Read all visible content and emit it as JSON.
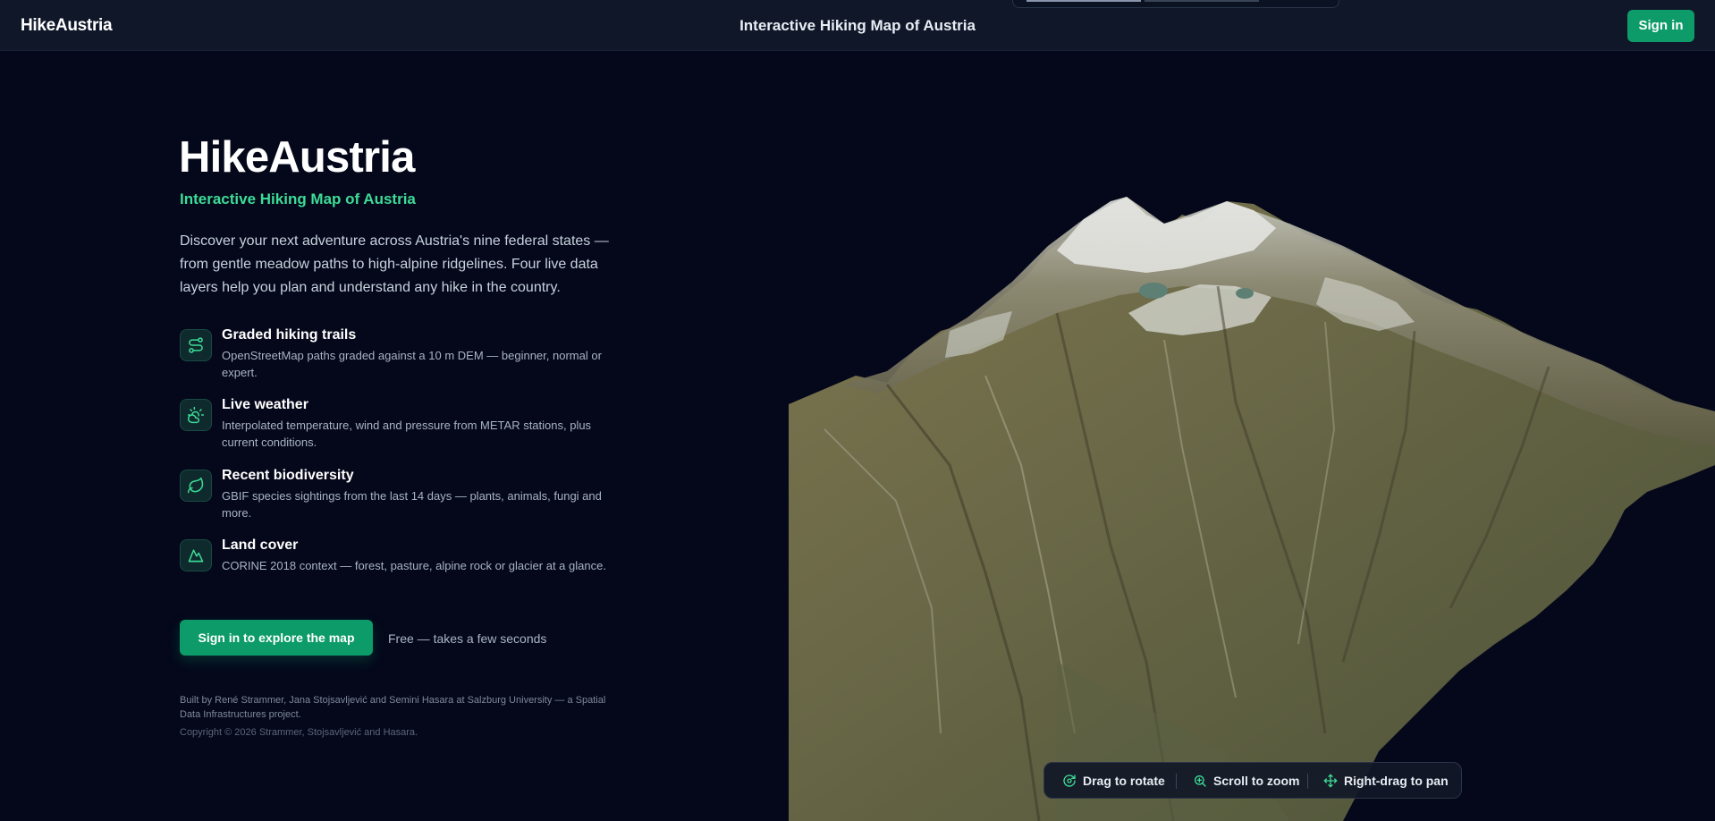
{
  "header": {
    "brand": "HikeAustria",
    "title": "Interactive Hiking Map of Austria",
    "signin_label": "Sign in"
  },
  "hero": {
    "title": "HikeAustria",
    "subtitle": "Interactive Hiking Map of Austria",
    "description": "Discover your next adventure across Austria's nine federal states — from gentle meadow paths to high-alpine ridgelines. Four live data layers help you plan and understand any hike in the country."
  },
  "features": [
    {
      "icon": "route-icon",
      "title": "Graded hiking trails",
      "description": "OpenStreetMap paths graded against a 10 m DEM — beginner, normal or expert."
    },
    {
      "icon": "sun-cloud-icon",
      "title": "Live weather",
      "description": "Interpolated temperature, wind and pressure from METAR stations, plus current conditions."
    },
    {
      "icon": "leaf-icon",
      "title": "Recent biodiversity",
      "description": "GBIF species sightings from the last 14 days — plants, animals, fungi and more."
    },
    {
      "icon": "mountain-icon",
      "title": "Land cover",
      "description": "CORINE 2018 context — forest, pasture, alpine rock or glacier at a glance."
    }
  ],
  "cta": {
    "button_label": "Sign in to explore the map",
    "note": "Free — takes a few seconds"
  },
  "footer": {
    "credit": "Built by René Strammer, Jana Stojsavljević and Semini Hasara at Salzburg University — a Spatial Data Infrastructures project.",
    "copyright": "Copyright © 2026 Strammer, Stojsavljević and Hasara."
  },
  "map_hints": [
    {
      "icon": "rotate-icon",
      "label": "Drag to rotate"
    },
    {
      "icon": "zoom-icon",
      "label": "Scroll to zoom"
    },
    {
      "icon": "move-icon",
      "label": "Right-drag to pan"
    }
  ],
  "colors": {
    "background": "#04081a",
    "topbar": "#0f1729",
    "accent": "#0d9b6a",
    "accent_text": "#3ddc97"
  }
}
